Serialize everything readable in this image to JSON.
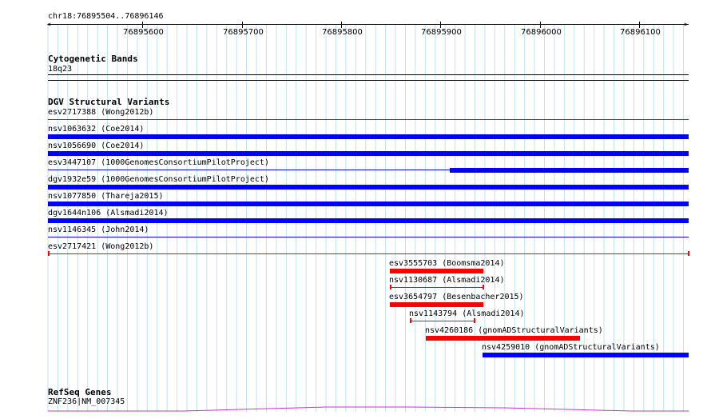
{
  "coords": "chr18:76895504..76896146",
  "ruler": {
    "ticks": [
      "76895600",
      "76895700",
      "76895800",
      "76895900",
      "76896000",
      "76896100"
    ]
  },
  "tracks": {
    "cytoband": {
      "title": "Cytogenetic Bands",
      "band": "18q23"
    },
    "dgv": {
      "title": "DGV Structural Variants",
      "features": [
        {
          "label": "esv2717388 (Wong2012b)",
          "color": "#ff0000",
          "kind": "line",
          "start": 0,
          "end": 1
        },
        {
          "label": "nsv1063632 (Coe2014)",
          "color": "#0000ff",
          "kind": "bar",
          "start": 0,
          "end": 1
        },
        {
          "label": "nsv1056690 (Coe2014)",
          "color": "#0000ff",
          "kind": "bar",
          "start": 0,
          "end": 1
        },
        {
          "label": "esv3447107 (1000GenomesConsortiumPilotProject)",
          "color": "#0000ff",
          "kind": "line-bar",
          "start": 0,
          "end": 1,
          "bar_start": 0.627
        },
        {
          "label": "dgv1932e59 (1000GenomesConsortiumPilotProject)",
          "color": "#0000ff",
          "kind": "bar",
          "start": 0,
          "end": 1
        },
        {
          "label": "nsv1077850 (Thareja2015)",
          "color": "#0000ff",
          "kind": "bar",
          "start": 0,
          "end": 1
        },
        {
          "label": "dgv1644n106 (Alsmadi2014)",
          "color": "#0000ff",
          "kind": "bar",
          "start": 0,
          "end": 1
        },
        {
          "label": "nsv1146345 (John2014)",
          "color": "#0000ff",
          "kind": "line",
          "start": 0,
          "end": 1
        },
        {
          "label": "esv2717421 (Wong2012b)",
          "color": "#ff0000",
          "kind": "bracket",
          "start": 0,
          "end": 1
        },
        {
          "label": "esv3555703 (Boomsma2014)",
          "color": "#ff0000",
          "kind": "bar",
          "start": 0.534,
          "end": 0.68
        },
        {
          "label": "nsv1130687 (Alsmadi2014)",
          "color": "#ff0000",
          "kind": "bracket",
          "start": 0.534,
          "end": 0.68
        },
        {
          "label": "esv3654797 (Besenbacher2015)",
          "color": "#ff0000",
          "kind": "bar",
          "start": 0.534,
          "end": 0.68
        },
        {
          "label": "nsv1143794 (Alsmadi2014)",
          "color": "#ff0000",
          "kind": "bracket",
          "start": 0.565,
          "end": 0.666
        },
        {
          "label": "nsv4260186 (gnomADStructuralVariants)",
          "color": "#ff0000",
          "kind": "bar",
          "start": 0.59,
          "end": 0.831
        },
        {
          "label": "nsv4259010 (gnomADStructuralVariants)",
          "color": "#0000ff",
          "kind": "bar",
          "start": 0.678,
          "end": 1
        }
      ]
    },
    "refseq": {
      "title": "RefSeq Genes",
      "gene": "ZNF236|NM_007345",
      "color": "#cc33cc"
    }
  }
}
